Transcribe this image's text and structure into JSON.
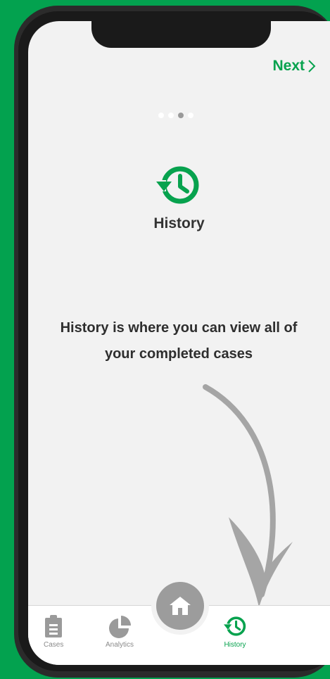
{
  "header": {
    "next_label": "Next"
  },
  "pager": {
    "total": 4,
    "active_index": 2
  },
  "intro": {
    "title": "History",
    "description": "History is where you can view all of your completed cases"
  },
  "tabbar": {
    "tabs": [
      {
        "label": "Cases",
        "icon": "clipboard-icon"
      },
      {
        "label": "Analytics",
        "icon": "pie-chart-icon"
      },
      {
        "label": "History",
        "icon": "history-icon",
        "active": true
      }
    ],
    "home_icon": "home-icon"
  },
  "colors": {
    "accent": "#07a24e",
    "background": "#03a24f",
    "inactive": "#8a8a8a"
  }
}
